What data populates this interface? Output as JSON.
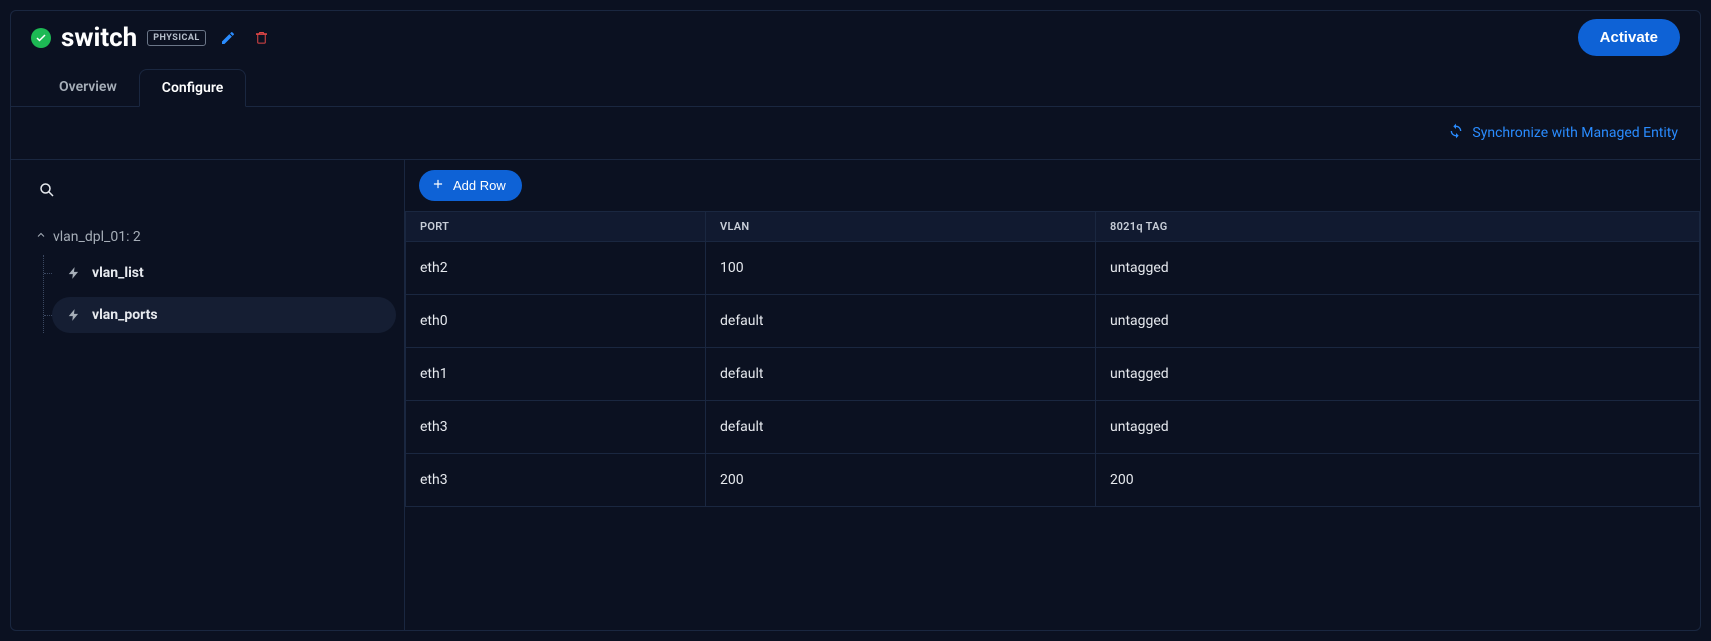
{
  "header": {
    "title": "switch",
    "badge": "PHYSICAL",
    "activate_label": "Activate"
  },
  "tabs": {
    "overview": "Overview",
    "configure": "Configure",
    "active": "configure"
  },
  "toolbar": {
    "sync_label": "Synchronize with Managed Entity"
  },
  "sidebar": {
    "root_label": "vlan_dpl_01: 2",
    "items": [
      {
        "label": "vlan_list",
        "selected": false
      },
      {
        "label": "vlan_ports",
        "selected": true
      }
    ]
  },
  "main": {
    "add_row_label": "Add Row",
    "columns": [
      "PORT",
      "VLAN",
      "8021q TAG"
    ],
    "rows": [
      {
        "port": "eth2",
        "vlan": "100",
        "tag": "untagged"
      },
      {
        "port": "eth0",
        "vlan": "default",
        "tag": "untagged"
      },
      {
        "port": "eth1",
        "vlan": "default",
        "tag": "untagged"
      },
      {
        "port": "eth3",
        "vlan": "default",
        "tag": "untagged"
      },
      {
        "port": "eth3",
        "vlan": "200",
        "tag": "200"
      }
    ]
  }
}
